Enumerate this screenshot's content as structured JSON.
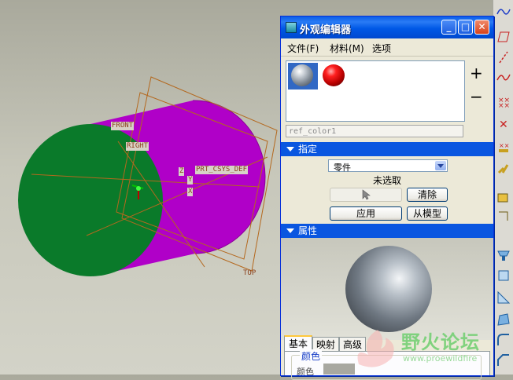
{
  "viewport": {
    "datum_labels": {
      "front": "FRONT",
      "right": "RIGHT",
      "top": "TOP",
      "csys": "PRT_CSYS_DEF"
    },
    "axis_marks": [
      "Z",
      "Y",
      "X"
    ],
    "colors": {
      "cylinder_side": "#b000c8",
      "cylinder_end": "#0a7a2a",
      "datum_plane": "#b4681e"
    }
  },
  "dialog": {
    "title": "外观编辑器",
    "window_buttons": {
      "minimize": "_",
      "maximize": "□",
      "close": "✕"
    },
    "menu": [
      {
        "label": "文件(F)"
      },
      {
        "label": "材料(M)"
      },
      {
        "label": "选项"
      }
    ],
    "materials": [
      {
        "icon": "gray-sphere-icon",
        "selected": true
      },
      {
        "icon": "red-sphere-icon",
        "selected": false
      }
    ],
    "add_label": "+",
    "remove_label": "−",
    "material_name": "ref_color1",
    "assign": {
      "header": "指定",
      "select_value": "零件",
      "status": "未选取",
      "clear_label": "清除",
      "apply_label": "应用",
      "from_model_label": "从模型"
    },
    "properties": {
      "header": "属性",
      "tabs": [
        "基本",
        "映射",
        "高级"
      ],
      "active_tab": "基本",
      "group_title": "颜色",
      "color_label": "颜色"
    }
  },
  "watermark": {
    "text": "野火论坛",
    "url": "www.proewildfire"
  }
}
